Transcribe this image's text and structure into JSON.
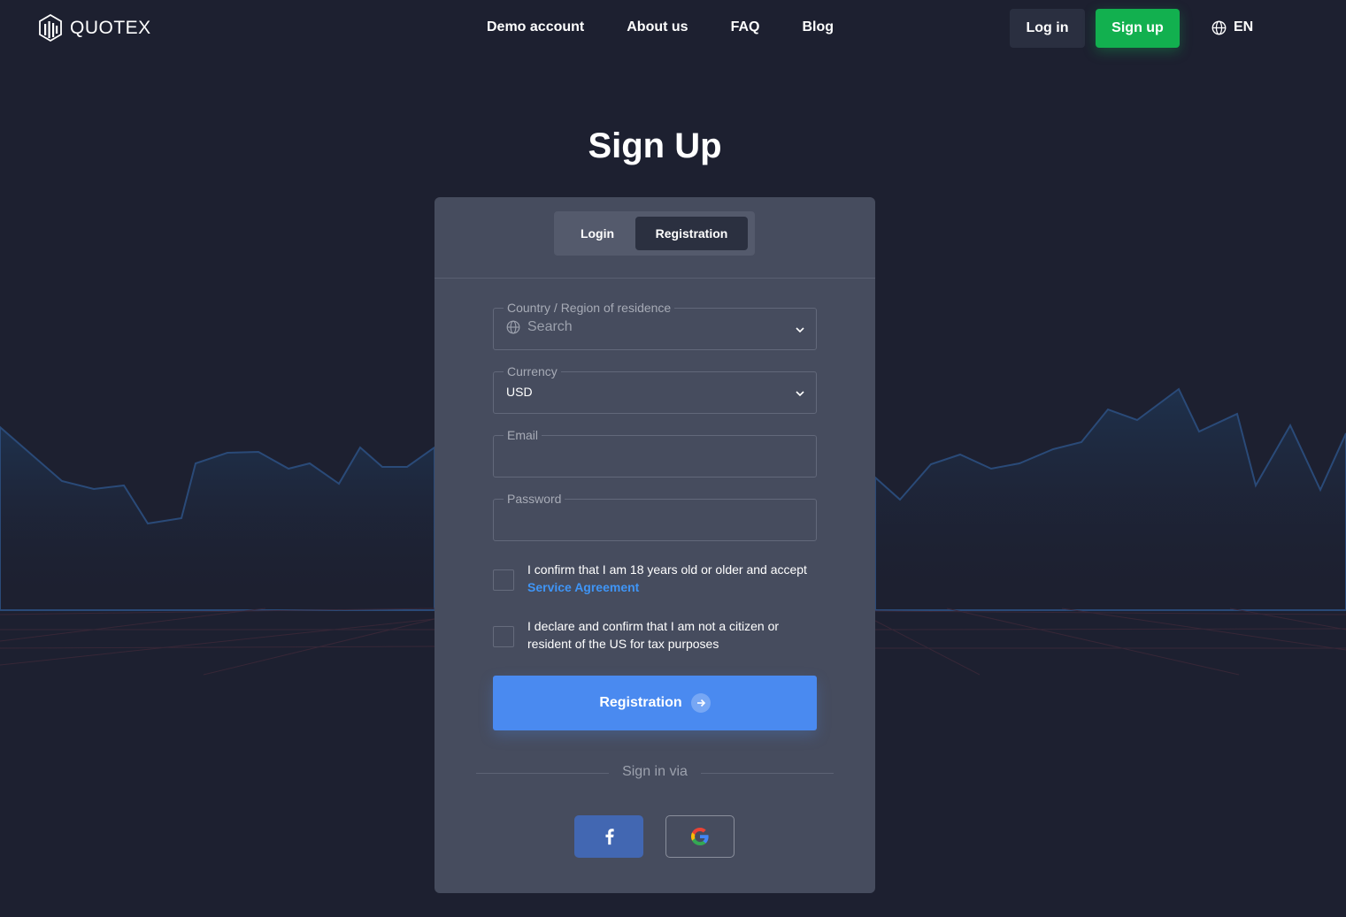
{
  "header": {
    "brand": "QUOTEX",
    "nav": [
      "Demo account",
      "About us",
      "FAQ",
      "Blog"
    ],
    "login_label": "Log in",
    "signup_label": "Sign up",
    "language": "EN"
  },
  "page": {
    "title": "Sign Up"
  },
  "tabs": {
    "login": "Login",
    "registration": "Registration",
    "active": "Registration"
  },
  "form": {
    "country": {
      "label": "Country / Region of residence",
      "placeholder": "Search"
    },
    "currency": {
      "label": "Currency",
      "value": "USD"
    },
    "email": {
      "label": "Email",
      "value": ""
    },
    "password": {
      "label": "Password",
      "value": ""
    },
    "age_confirm": {
      "text": "I confirm that I am 18 years old or older and accept",
      "link": "Service Agreement",
      "checked": false
    },
    "us_confirm": {
      "text": "I declare and confirm that I am not a citizen or resident of the US for tax purposes",
      "checked": false
    },
    "submit_label": "Registration"
  },
  "social": {
    "divider_text": "Sign in via",
    "providers": [
      "facebook",
      "google"
    ]
  },
  "icons": {
    "logo": "quotex-logo-icon",
    "language": "globe-icon",
    "country": "globe-icon",
    "dropdown": "chevron-down-icon",
    "submit": "arrow-right-icon",
    "facebook": "facebook-icon",
    "google": "google-icon"
  },
  "colors": {
    "background": "#1d2030",
    "card": "#464c5e",
    "signup": "#12b04f",
    "primary": "#4a8af0",
    "link": "#3f95f6",
    "facebook": "#4267b2"
  }
}
